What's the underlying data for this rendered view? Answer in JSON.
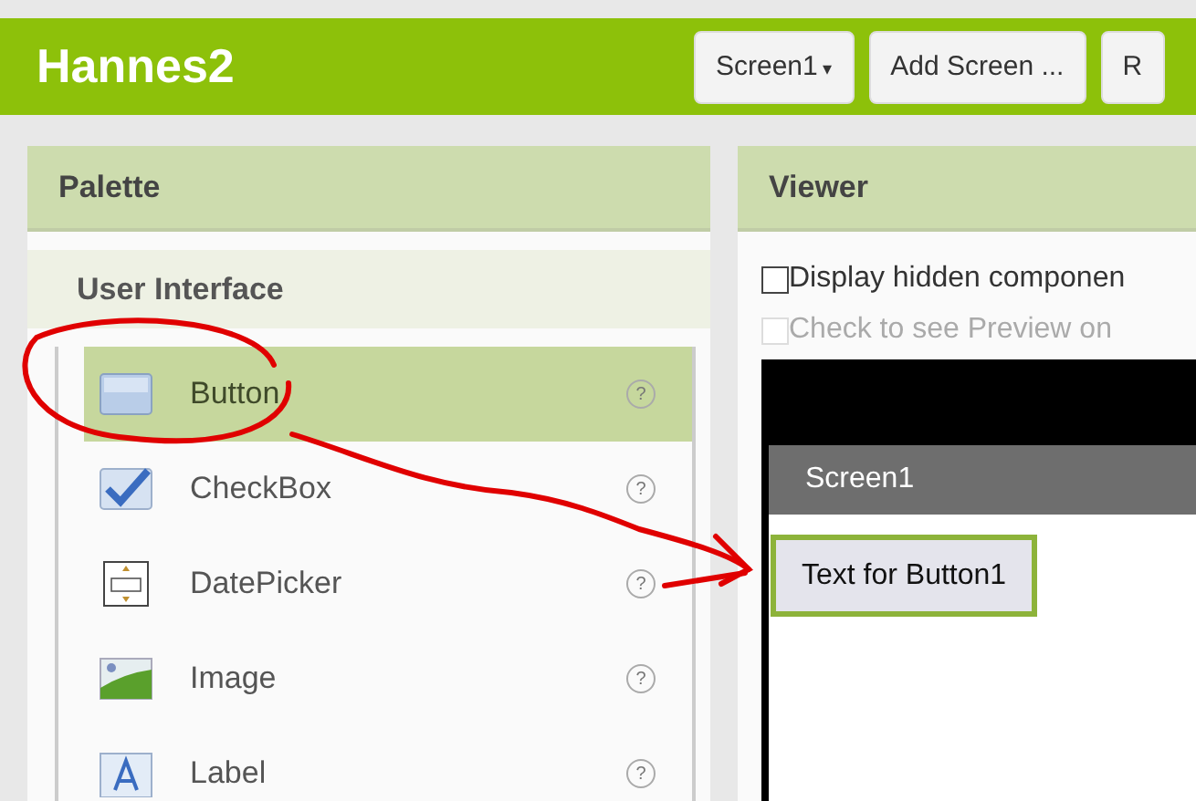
{
  "header": {
    "title": "Hannes2",
    "buttons": [
      {
        "label": "Screen1",
        "kind": "dropdown",
        "caret": "▾"
      },
      {
        "label": "Add Screen ...",
        "kind": "plain"
      },
      {
        "label": "R",
        "kind": "plain"
      }
    ]
  },
  "palette": {
    "title": "Palette",
    "category": "User Interface",
    "items": [
      {
        "label": "Button",
        "kind": "button",
        "help": "?",
        "selected": true
      },
      {
        "label": "CheckBox",
        "kind": "checkbox",
        "help": "?",
        "selected": false
      },
      {
        "label": "DatePicker",
        "kind": "datepicker",
        "help": "?",
        "selected": false
      },
      {
        "label": "Image",
        "kind": "image",
        "help": "?",
        "selected": false
      },
      {
        "label": "Label",
        "kind": "label",
        "help": "?",
        "selected": false
      }
    ]
  },
  "viewer": {
    "title": "Viewer",
    "options": [
      {
        "label": "Display hidden componen",
        "checked": false,
        "disabled": false
      },
      {
        "label": "Check to see Preview on ",
        "checked": false,
        "disabled": true
      }
    ],
    "screen_title": "Screen1",
    "components": [
      {
        "label": "Text for Button1",
        "selected": true
      }
    ]
  }
}
